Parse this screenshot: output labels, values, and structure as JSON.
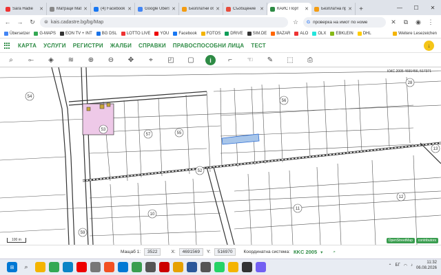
{
  "browser": {
    "tabs": [
      {
        "title": "Sara Hadie",
        "color": "#e33"
      },
      {
        "title": "Матраци Matt",
        "color": "#888"
      },
      {
        "title": "(4) Facebook",
        "color": "#1877f2"
      },
      {
        "title": "Google Überse",
        "color": "#4285f4"
      },
      {
        "title": "Безплатни об",
        "color": "#f39c12"
      },
      {
        "title": "Съобщение",
        "color": "#e74c3c"
      },
      {
        "title": "КАИС Порт",
        "color": "#2e8b45",
        "active": true
      },
      {
        "title": "Безплатна пр",
        "color": "#f39c12"
      }
    ],
    "new_tab": "+",
    "window_controls": {
      "minimize": "—",
      "maximize": "☐",
      "close": "✕"
    },
    "url": "kais.cadastre.bg/bg/Map",
    "search_text": "проверка на имот по номе",
    "bookmarks": [
      {
        "label": "Übersetzer",
        "color": "#4285f4"
      },
      {
        "label": "G-MAPS",
        "color": "#34a853"
      },
      {
        "label": "EON TV + INT",
        "color": "#333"
      },
      {
        "label": "BG DSL",
        "color": "#1a73e8"
      },
      {
        "label": "LOTTO LIVE",
        "color": "#e33"
      },
      {
        "label": "YOU",
        "color": "#e00"
      },
      {
        "label": "Facebook",
        "color": "#1877f2"
      },
      {
        "label": "FOTOS",
        "color": "#f4b400"
      },
      {
        "label": "DRIVE",
        "color": "#0f9d58"
      },
      {
        "label": "SIM.DE",
        "color": "#333"
      },
      {
        "label": "BAZAR",
        "color": "#f60"
      },
      {
        "label": "ALO",
        "color": "#e33"
      },
      {
        "label": "OLX",
        "color": "#23e5db"
      },
      {
        "label": "EBKLEIN",
        "color": "#86b817"
      },
      {
        "label": "DHL",
        "color": "#fc0"
      }
    ],
    "bookmarks_right": "Weitere Lesezeichen"
  },
  "menu": [
    "КАРТА",
    "УСЛУГИ",
    "РЕГИСТРИ",
    "ЖАЛБИ",
    "СПРАВКИ",
    "ПРАВОСПОСОБНИ ЛИЦА",
    "ТЕСТ"
  ],
  "tools": [
    "search-icon",
    "measure-icon",
    "layers-icon",
    "stack-icon",
    "zoom-in-icon",
    "zoom-out-icon",
    "pan-icon",
    "pin-icon",
    "select-icon",
    "box-icon",
    "info-icon",
    "corner-icon",
    "hand-icon",
    "draw-icon",
    "shape-icon",
    "print-icon"
  ],
  "map": {
    "coords_label": "КЖС 2005 4691456, 517371",
    "parcels": [
      "54",
      "53",
      "55",
      "56",
      "28",
      "57",
      "13",
      "52",
      "10",
      "11",
      "12",
      "59"
    ],
    "scale_label": "100 m",
    "attribution": [
      "OpenStreetMap",
      "contributors"
    ]
  },
  "status": {
    "scale_label": "Мащаб 1:",
    "scale_value": "3522",
    "x_label": "X:",
    "x_value": "4691569",
    "y_label": "Y:",
    "y_value": "516970",
    "coord_system_label": "Координатна система:",
    "coord_system_value": "КKC 2005"
  },
  "taskbar": {
    "apps": [
      {
        "name": "windows-start-icon",
        "color": "#0078d4"
      },
      {
        "name": "files-icon",
        "color": "#f4b400"
      },
      {
        "name": "chrome-icon",
        "color": "#34a853"
      },
      {
        "name": "edge-icon",
        "color": "#0a84c6"
      },
      {
        "name": "opera-icon",
        "color": "#e00"
      },
      {
        "name": "settings-icon",
        "color": "#777"
      },
      {
        "name": "brave-icon",
        "color": "#f25022"
      },
      {
        "name": "mail-icon",
        "color": "#0078d4"
      },
      {
        "name": "photos-icon",
        "color": "#3a9d4f"
      },
      {
        "name": "store-icon",
        "color": "#555"
      },
      {
        "name": "video-icon",
        "color": "#c00"
      },
      {
        "name": "paint-icon",
        "color": "#e6a100"
      },
      {
        "name": "word-icon",
        "color": "#2b579a"
      },
      {
        "name": "calc-icon",
        "color": "#555"
      },
      {
        "name": "whatsapp-icon",
        "color": "#25d366"
      },
      {
        "name": "folder-icon",
        "color": "#f4b400"
      },
      {
        "name": "terminal-icon",
        "color": "#333"
      },
      {
        "name": "viber-icon",
        "color": "#7360f2"
      }
    ],
    "lang": "БГ",
    "time": "11:32",
    "date": "06.08.2026"
  }
}
